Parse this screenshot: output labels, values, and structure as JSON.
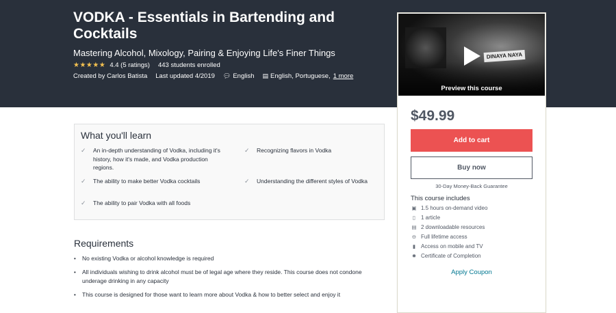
{
  "course": {
    "title": "VODKA - Essentials in Bartending and Cocktails",
    "subtitle": "Mastering Alcohol, Mixology, Pairing & Enjoying Life's Finer Things",
    "stars": "★★★★★",
    "rating": "4.4 (5 ratings)",
    "enrolled": "443 students enrolled",
    "created_by": "Created by Carlos Batista",
    "last_updated": "Last updated 4/2019",
    "language": "English",
    "captions": "English, Portuguese,",
    "more_link": "1 more"
  },
  "sidebar": {
    "preview_label": "Preview this course",
    "sign_text": "DINAYA NAYA",
    "price": "$49.99",
    "add_to_cart": "Add to cart",
    "buy_now": "Buy now",
    "guarantee": "30-Day Money-Back Guarantee",
    "includes_title": "This course includes",
    "includes": [
      {
        "icon": "video-icon",
        "text": "1.5 hours on-demand video"
      },
      {
        "icon": "file-icon",
        "text": "1 article"
      },
      {
        "icon": "download-icon",
        "text": "2 downloadable resources"
      },
      {
        "icon": "infinity-icon",
        "text": "Full lifetime access"
      },
      {
        "icon": "mobile-icon",
        "text": "Access on mobile and TV"
      },
      {
        "icon": "certificate-icon",
        "text": "Certificate of Completion"
      }
    ],
    "apply_coupon": "Apply Coupon"
  },
  "learn": {
    "title": "What you'll learn",
    "items": [
      "An in-depth understanding of Vodka, including it's history, how it's made, and Vodka production regions.",
      "Recognizing flavors in Vodka",
      "The ability to make better Vodka cocktails",
      "Understanding the different styles of Vodka",
      "The ability to pair Vodka with all foods"
    ]
  },
  "requirements": {
    "title": "Requirements",
    "items": [
      "No existing Vodka or alcohol knowledge is required",
      "All individuals wishing to drink alcohol must be of legal age where they reside. This course does not condone underage drinking in any capacity",
      "This course is designed for those want to learn more about Vodka & how to better select and enjoy it"
    ]
  },
  "colors": {
    "hero_bg": "#29303b",
    "star": "#f4c150",
    "cart_button": "#ec5252",
    "link": "#007791"
  }
}
